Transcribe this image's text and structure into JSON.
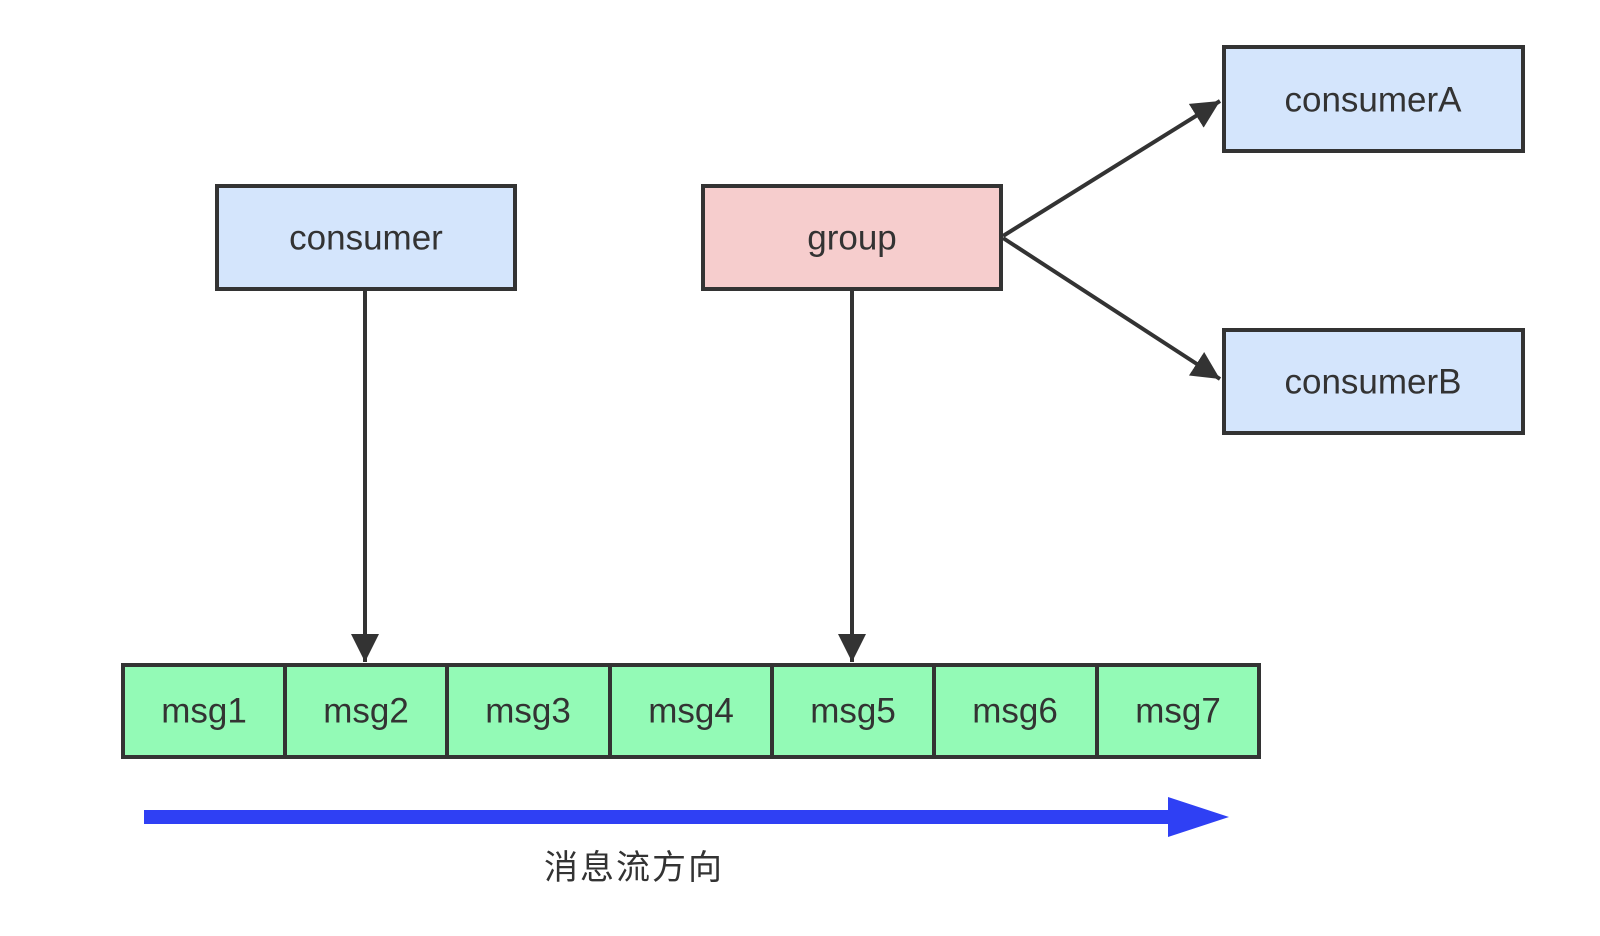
{
  "diagram": {
    "boxes": {
      "consumer": "consumer",
      "group": "group",
      "consumerA": "consumerA",
      "consumerB": "consumerB"
    },
    "messages": [
      "msg1",
      "msg2",
      "msg3",
      "msg4",
      "msg5",
      "msg6",
      "msg7"
    ],
    "caption": "消息流方向"
  },
  "colors": {
    "consumer_fill": "#d4e5fc",
    "group_fill": "#f6cdcd",
    "message_fill": "#93fab6",
    "stroke": "#333333",
    "flow_arrow": "#2f40f4"
  }
}
